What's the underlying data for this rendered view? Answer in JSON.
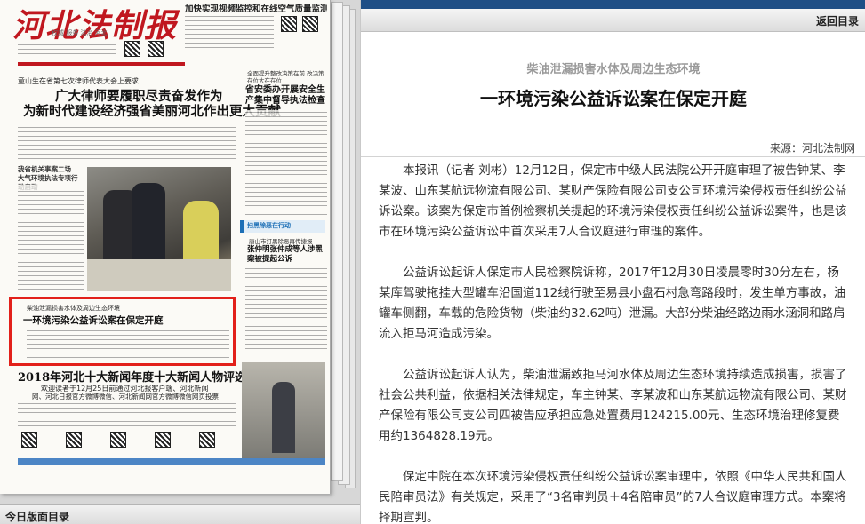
{
  "left": {
    "masthead": "河北法制报",
    "masthead_sub": "权威 服务 法治 河北",
    "top_headline": "加快实现视频监控和在线空气质量监测全覆盖",
    "lead_kicker": "童山生在省第七次律师代表大会上要求",
    "lead_title_1": "广大律师要履职尽责奋发作为",
    "lead_title_2": "为新时代建设经济强省美丽河北作出更大贡献",
    "right_col_kicker": "全面提升整改决策在前 改决策在位大在在位",
    "right_col_title": "省安委办开展安全生产集中督导执法检查",
    "side_head_1": "我省机关事案二场 大气环境执法专项行动启动",
    "blue_bar_text": "扫黑除恶在行动",
    "side_kicker_2": "唐山市打黑除恶再传捷报",
    "side_title_2": "张仲明张仲成等人涉黑案被提起公诉",
    "hl_kicker": "柴油泄漏损害水体及周边生态环境",
    "hl_title": "一环境污染公益诉讼案在保定开庭",
    "lower_headline": "2018年河北十大新闻年度十大新闻人物评选启动",
    "lower_sub_1": "欢迎读者于12月25日前通过河北报客户端、河北新闻",
    "lower_sub_2": "网、河北日报官方微博微信、河北新闻网官方微博微信网页投票",
    "bottom_bar": "今日版面目录"
  },
  "right": {
    "back_link": "返回目录",
    "subtitle": "柴油泄漏损害水体及周边生态环境",
    "title": "一环境污染公益诉讼案在保定开庭",
    "source": "来源：河北法制网",
    "paragraphs": [
      "本报讯（记者 刘彬）12月12日，保定市中级人民法院公开开庭审理了被告钟某、李某波、山东某航远物流有限公司、某财产保险有限公司支公司环境污染侵权责任纠纷公益诉讼案。该案为保定市首例检察机关提起的环境污染侵权责任纠纷公益诉讼案件，也是该市在环境污染公益诉讼中首次采用7人合议庭进行审理的案件。",
      "公益诉讼起诉人保定市人民检察院诉称，2017年12月30日凌晨零时30分左右，杨某库驾驶拖挂大型罐车沿国道112线行驶至易县小盘石村急弯路段时，发生单方事故，油罐车侧翻，车载的危险货物（柴油约32.62吨）泄漏。大部分柴油经路边雨水涵洞和路肩流入拒马河造成污染。",
      "公益诉讼起诉人认为，柴油泄漏致拒马河水体及周边生态环境持续造成损害，损害了社会公共利益，依据相关法律规定，车主钟某、李某波和山东某航远物流有限公司、某财产保险有限公司支公司四被告应承担应急处置费用124215.00元、生态环境治理修复费用约1364828.19元。",
      "保定中院在本次环境污染侵权责任纠纷公益诉讼案审理中，依照《中华人民共和国人民陪审员法》有关规定，采用了“3名审判员＋4名陪审员”的7人合议庭审理方式。本案将择期宣判。"
    ]
  }
}
